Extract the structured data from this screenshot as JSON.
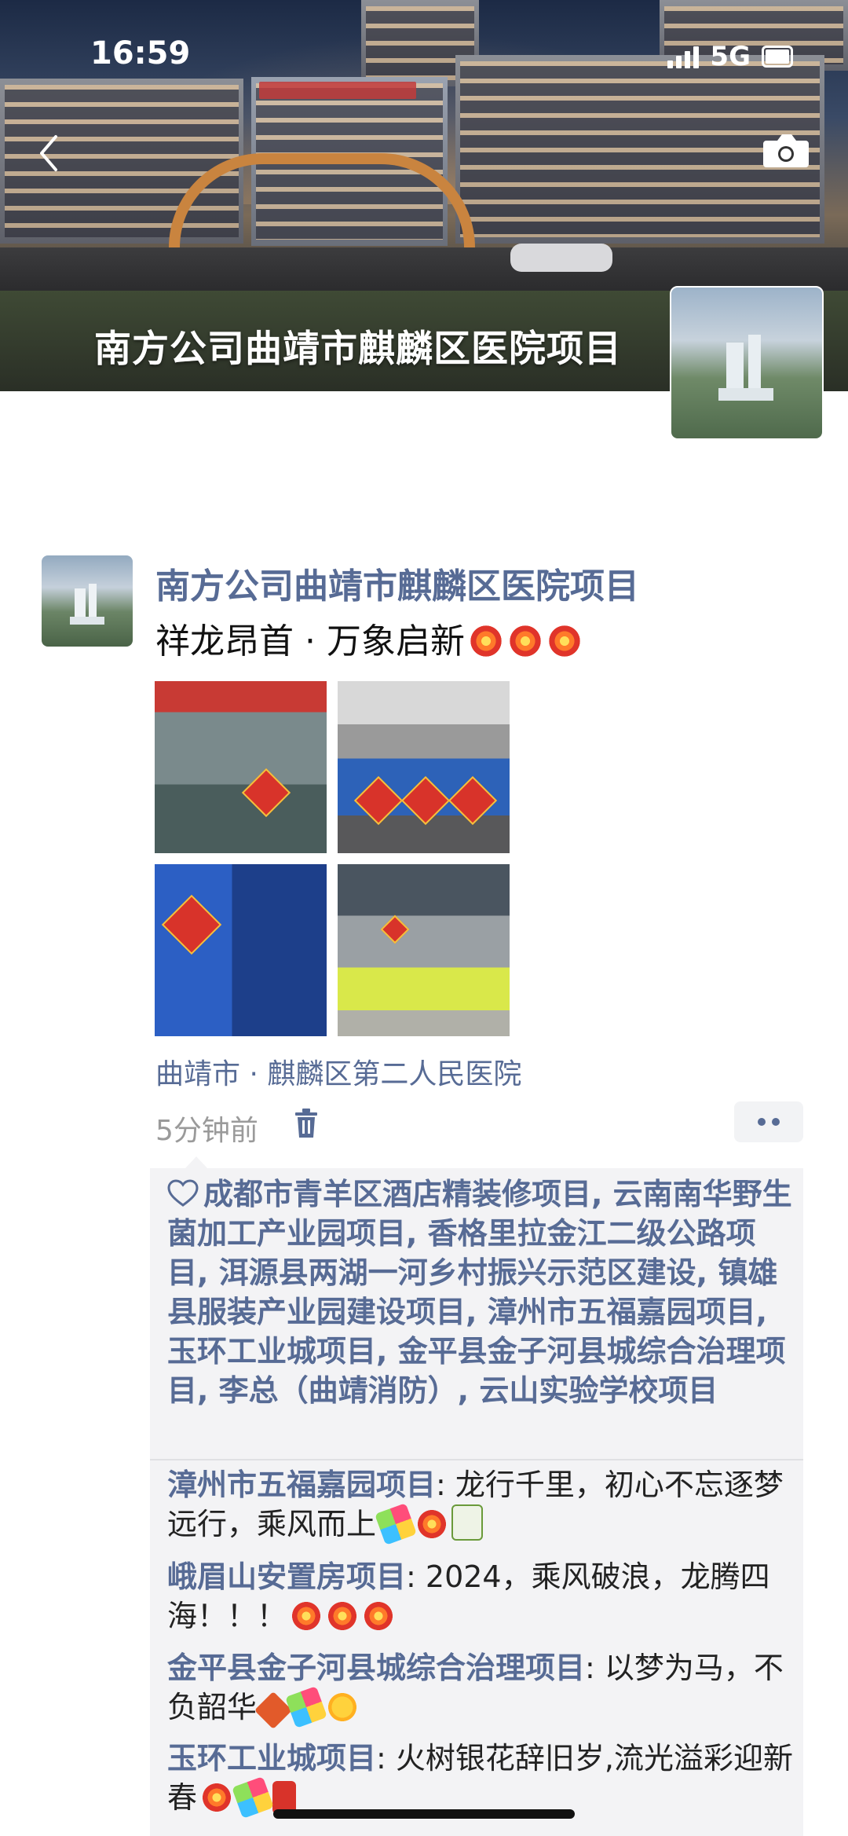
{
  "status_bar": {
    "time": "16:59",
    "network": "5G"
  },
  "cover": {
    "title": "南方公司曲靖市麒麟区医院项目"
  },
  "post": {
    "author": "南方公司曲靖市麒麟区医院项目",
    "text": "祥龙昂首 · 万象启新",
    "text_emojis": [
      "firework-icon",
      "firework-icon",
      "firework-icon"
    ],
    "photo_count": 4,
    "location": "曲靖市 · 麒麟区第二人民医院",
    "time_ago": "5分钟前"
  },
  "likes": {
    "names": "成都市青羊区酒店精装修项目, 云南南华野生菌加工产业园项目, 香格里拉金江二级公路项目, 洱源县两湖一河乡村振兴示范区建设, 镇雄县服装产业园建设项目, 漳州市五福嘉园项目, 玉环工业城项目, 金平县金子河县城综合治理项目, 李总（曲靖消防）, 云山实验学校项目"
  },
  "comments": [
    {
      "author": "漳州市五福嘉园项目",
      "text": ": 龙行千里，初心不忘逐梦远行，乘风而上"
    },
    {
      "author": "峨眉山安置房项目",
      "text": ": 2024，乘风破浪，龙腾四海！！！"
    },
    {
      "author": "金平县金子河县城综合治理项目",
      "text": ": 以梦为马，不负韶华"
    },
    {
      "author": "玉环工业城项目",
      "text": ": 火树银花辞旧岁,流光溢彩迎新春"
    }
  ],
  "colors": {
    "link": "#576b95",
    "box_bg": "#f3f3f5"
  }
}
